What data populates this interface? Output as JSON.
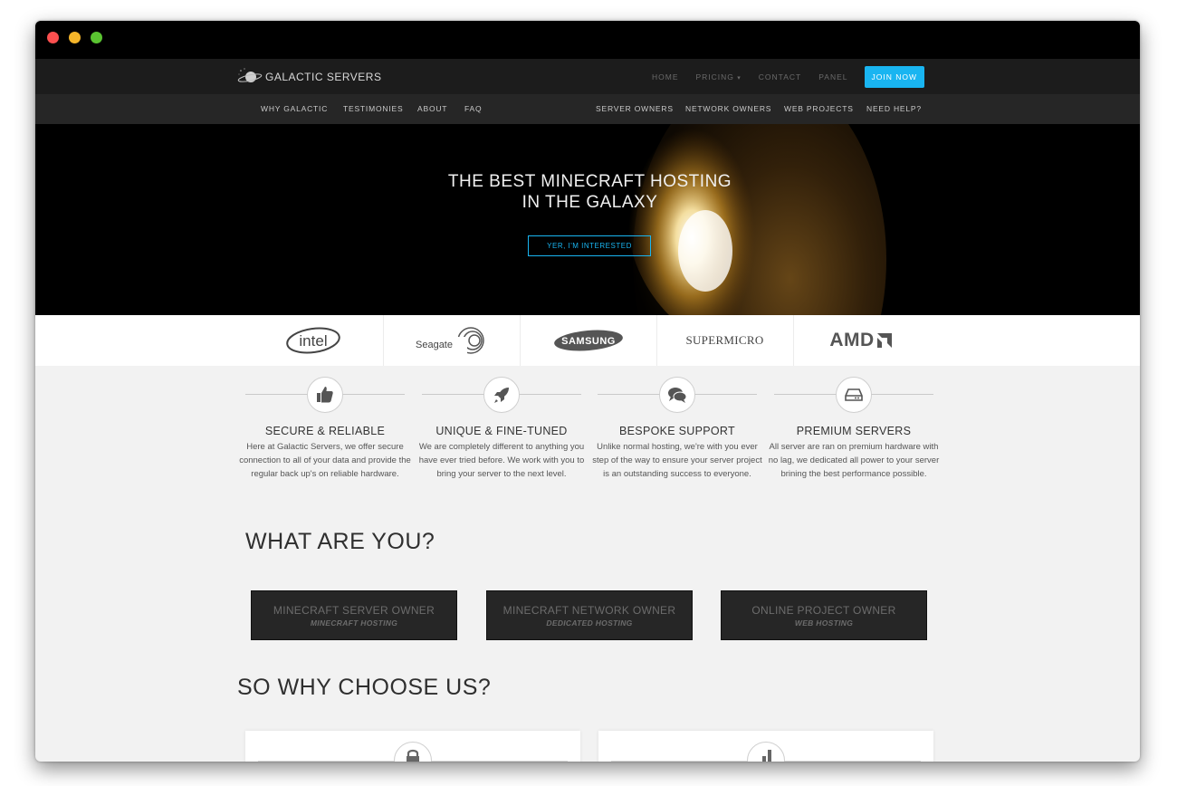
{
  "brand": {
    "name": "GALACTIC SERVERS"
  },
  "top_nav": [
    "HOME",
    "PRICING",
    "CONTACT",
    "PANEL"
  ],
  "top_nav_caret": "▾",
  "join_label": "JOIN NOW",
  "sub_nav_left": [
    "WHY GALACTIC",
    "TESTIMONIES",
    "ABOUT",
    "FAQ"
  ],
  "sub_nav_right": [
    "SERVER OWNERS",
    "NETWORK OWNERS",
    "WEB PROJECTS",
    "NEED HELP?"
  ],
  "hero": {
    "title_line1": "THE BEST MINECRAFT HOSTING",
    "title_line2": "IN THE GALAXY",
    "button": "YER, I'M INTERESTED"
  },
  "partners": [
    "intel",
    "Seagate",
    "SAMSUNG",
    "SUPERMICRO",
    "AMD"
  ],
  "features": [
    {
      "icon": "thumbs-up-icon",
      "title": "SECURE & RELIABLE",
      "text": "Here at Galactic Servers, we offer secure connection to all of your data and provide the regular back up's on reliable hardware."
    },
    {
      "icon": "rocket-icon",
      "title": "UNIQUE & FINE-TUNED",
      "text": "We are completely different to anything you have ever tried before. We work with you to bring your server to the next level."
    },
    {
      "icon": "chat-bubbles-icon",
      "title": "BESPOKE SUPPORT",
      "text": "Unlike normal hosting, we're with you ever step of the way to ensure your server project is an outstanding success to everyone."
    },
    {
      "icon": "hard-drive-icon",
      "title": "PREMIUM SERVERS",
      "text": "All server are ran on premium hardware with no lag, we dedicated all power to your server brining the best performance possible."
    }
  ],
  "what_are_you": {
    "title": "WHAT ARE YOU?",
    "choices": [
      {
        "title": "MINECRAFT SERVER OWNER",
        "subtitle": "MINECRAFT HOSTING"
      },
      {
        "title": "MINECRAFT NETWORK OWNER",
        "subtitle": "DEDICATED HOSTING"
      },
      {
        "title": "ONLINE PROJECT OWNER",
        "subtitle": "WEB HOSTING"
      }
    ]
  },
  "why_choose": {
    "title": "SO WHY CHOOSE US?",
    "cards": [
      {
        "icon": "lock-icon"
      },
      {
        "icon": "bar-chart-icon"
      }
    ]
  },
  "colors": {
    "accent": "#19b5f1",
    "dark_bar": "#1c1c1c",
    "subnav": "#262626",
    "page_bg": "#f2f2f2"
  }
}
